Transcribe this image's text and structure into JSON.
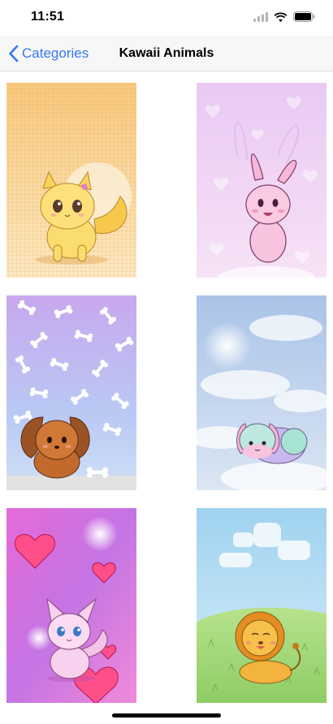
{
  "status_bar": {
    "time": "11:51",
    "icons": [
      "cellular-signal-icon",
      "wifi-icon",
      "battery-icon"
    ]
  },
  "nav_bar": {
    "back_label": "Categories",
    "title": "Kawaii Animals",
    "accent_color": "#3478f6"
  },
  "grid": {
    "items": [
      {
        "subject": "yellow-fox"
      },
      {
        "subject": "pink-bunny"
      },
      {
        "subject": "brown-puppy"
      },
      {
        "subject": "pastel-puppy"
      },
      {
        "subject": "pink-kitten"
      },
      {
        "subject": "lion-cub"
      }
    ]
  }
}
